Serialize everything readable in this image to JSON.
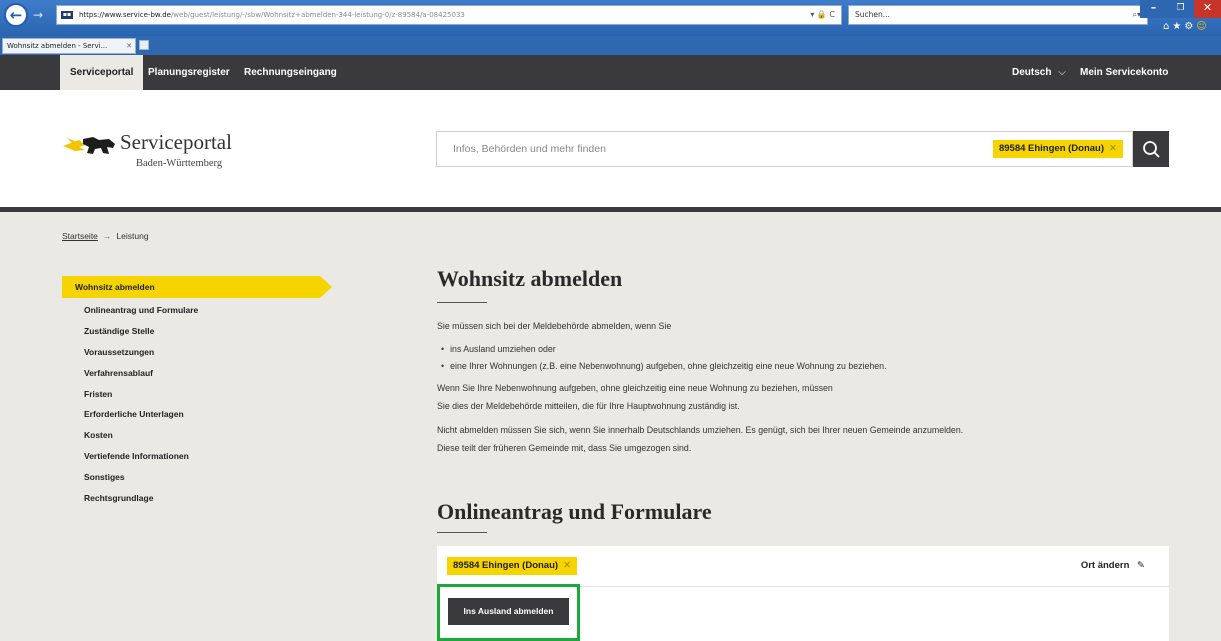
{
  "browser": {
    "url_host": "https://www.service-bw.de",
    "url_path": "/web/guest/leistung/-/sbw/Wohnsitz+abmelden-344-leistung-0/z-89584/a-08425033",
    "address_right": "▾ 🔒 C",
    "search_placeholder": "Suchen...",
    "tab_title": "Wohnsitz abmelden - Servi...",
    "tab_close": "✕"
  },
  "nav": {
    "items": [
      "Serviceportal",
      "Planungsregister",
      "Rechnungseingang"
    ],
    "language": "Deutsch",
    "account": "Mein Servicekonto"
  },
  "header": {
    "logo_title": "Serviceportal",
    "logo_subtitle": "Baden-Württemberg",
    "search_placeholder": "Infos, Behörden und mehr finden",
    "location": "89584 Ehingen (Donau)"
  },
  "breadcrumb": {
    "home": "Startseite",
    "separator": "→",
    "current": "Leistung"
  },
  "sidebar": {
    "active": "Wohnsitz abmelden",
    "items": [
      "Onlineantrag und Formulare",
      "Zuständige Stelle",
      "Voraussetzungen",
      "Verfahrensablauf",
      "Fristen",
      "Erforderliche Unterlagen",
      "Kosten",
      "Vertiefende Informationen",
      "Sonstiges",
      "Rechtsgrundlage"
    ]
  },
  "main": {
    "title": "Wohnsitz abmelden",
    "intro": "Sie müssen sich bei der Meldebehörde abmelden, wenn Sie",
    "bullets": [
      "ins Ausland umziehen oder",
      "eine Ihrer Wohnungen (z.B. eine Nebenwohnung) aufgeben, ohne gleichzeitig eine neue Wohnung zu beziehen."
    ],
    "para1_line1": "Wenn Sie Ihre Nebenwohnung aufgeben, ohne gleichzeitig eine neue Wohnung zu beziehen, müssen",
    "para1_line2": "Sie dies der Meldebehörde mitteilen, die für Ihre Hauptwohnung zuständig ist.",
    "para2_line1": "Nicht abmelden müssen Sie sich, wenn Sie innerhalb Deutschlands umziehen. Es genügt, sich bei Ihrer neuen Gemeinde anzumelden.",
    "para2_line2": "Diese teilt der früheren Gemeinde mit, dass Sie umgezogen sind.",
    "section_title": "Onlineantrag und Formulare",
    "location": "89584 Ehingen (Donau)",
    "change_location": "Ort ändern",
    "action_button": "Ins Ausland abmelden"
  },
  "colors": {
    "accent_yellow": "#f5d400",
    "dark": "#3a3a3d",
    "highlight_green": "#1aa93a",
    "background": "#ebe9e4"
  }
}
